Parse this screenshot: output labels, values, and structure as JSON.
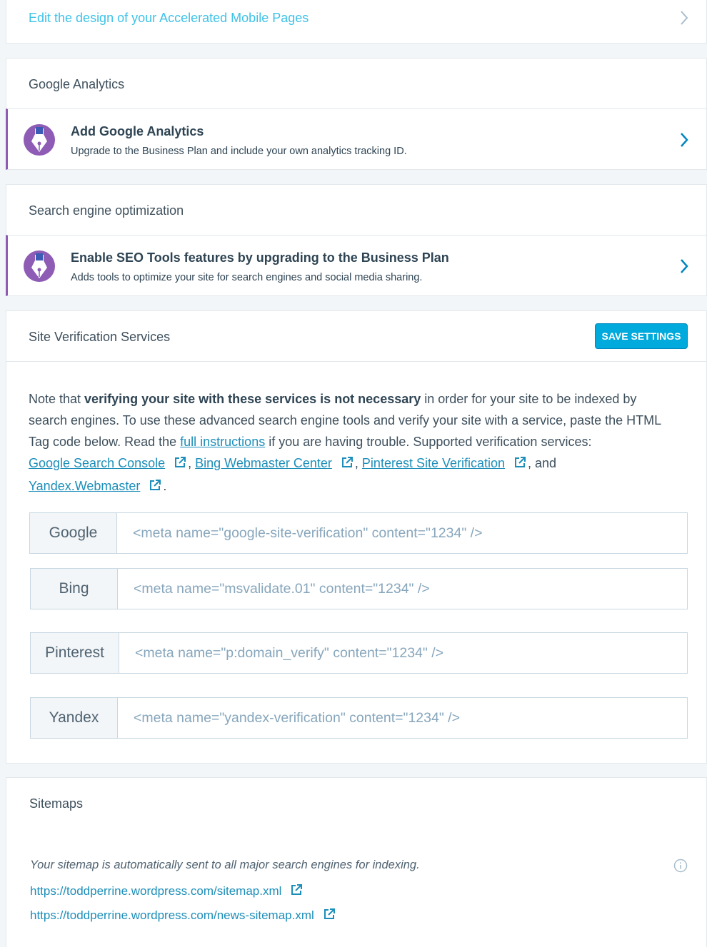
{
  "amp": {
    "link_text": "Edit the design of your Accelerated Mobile Pages"
  },
  "analytics": {
    "header": "Google Analytics",
    "nudge_title": "Add Google Analytics",
    "nudge_desc": "Upgrade to the Business Plan and include your own analytics tracking ID."
  },
  "seo": {
    "header": "Search engine optimization",
    "nudge_title": "Enable SEO Tools features by upgrading to the Business Plan",
    "nudge_desc": "Adds tools to optimize your site for search engines and social media sharing."
  },
  "verification": {
    "header": "Site Verification Services",
    "save_label": "SAVE SETTINGS",
    "note_1": "Note that ",
    "note_bold": "verifying your site with these services is not necessary",
    "note_2": " in order for your site to be indexed by search engines. To use these advanced search engine tools and verify your site with a service, paste the HTML Tag code below. Read the ",
    "note_link": "full instructions",
    "note_3": " if you are having trouble. Supported verification services: ",
    "services": [
      "Google Search Console",
      "Bing Webmaster Center",
      "Pinterest Site Verification",
      "Yandex.Webmaster"
    ],
    "sep_comma": ", ",
    "sep_and": ", and",
    "sep_end": ".",
    "fields": [
      {
        "label": "Google",
        "placeholder": "<meta name=\"google-site-verification\" content=\"1234\" />"
      },
      {
        "label": "Bing",
        "placeholder": "<meta name=\"msvalidate.01\" content=\"1234\" />"
      },
      {
        "label": "Pinterest",
        "placeholder": "<meta name=\"p:domain_verify\" content=\"1234\" />"
      },
      {
        "label": "Yandex",
        "placeholder": "<meta name=\"yandex-verification\" content=\"1234\" />"
      }
    ]
  },
  "sitemaps": {
    "header": "Sitemaps",
    "note": "Your sitemap is automatically sent to all major search engines for indexing.",
    "links": [
      "https://toddperrine.wordpress.com/sitemap.xml",
      "https://toddperrine.wordpress.com/news-sitemap.xml"
    ]
  },
  "colors": {
    "accent": "#00aadc",
    "link": "#1c8eb9",
    "amp_link": "#3ec2e8",
    "nudge": "#8e5bb5"
  },
  "icons": [
    "chevron-right-icon",
    "fountain-pen-icon",
    "external-link-icon",
    "info-icon"
  ]
}
